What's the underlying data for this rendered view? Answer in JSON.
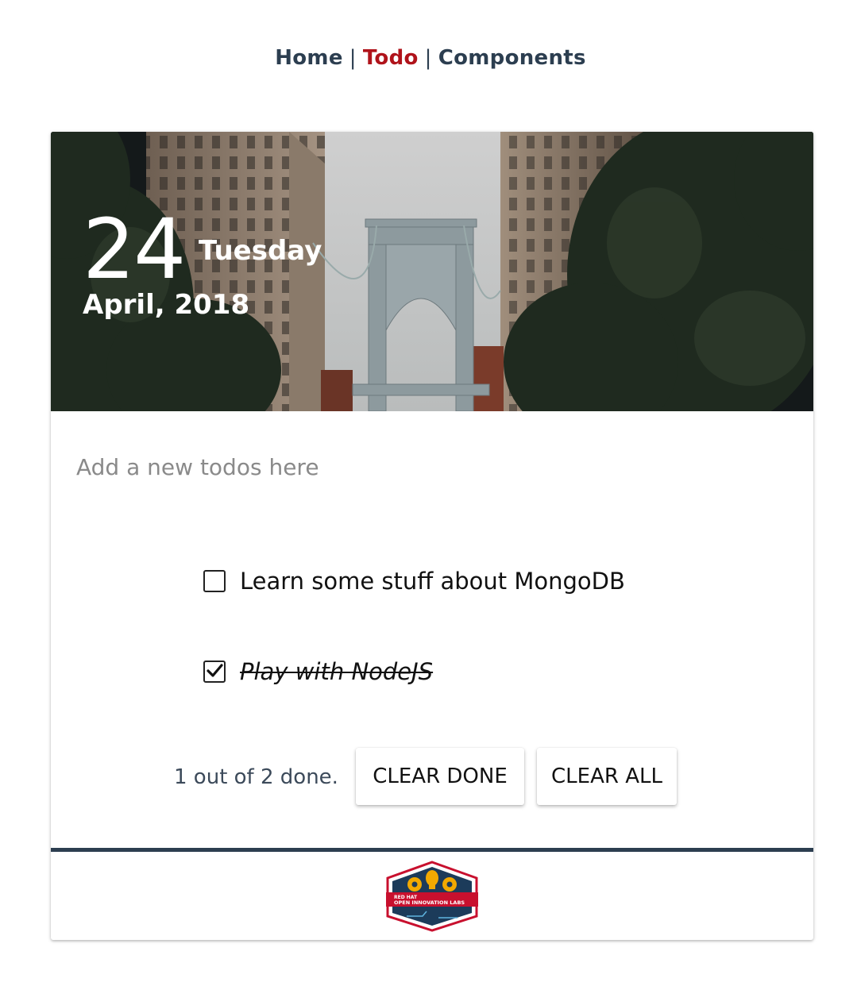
{
  "nav": {
    "home": "Home",
    "todo": "Todo",
    "components": "Components",
    "separator": "|",
    "active_color": "#b0131b",
    "text_color": "#2c3e50"
  },
  "header": {
    "day": "24",
    "weekday": "Tuesday",
    "month_year": "April, 2018"
  },
  "new_todo": {
    "placeholder": "Add a new todos here",
    "value": ""
  },
  "todos": [
    {
      "title": "Learn some stuff about MongoDB",
      "completed": false
    },
    {
      "title": "Play with NodeJS",
      "completed": true
    }
  ],
  "footer": {
    "counter": "1 out of 2 done.",
    "clear_done_label": "CLEAR DONE",
    "clear_all_label": "CLEAR ALL"
  },
  "logo": {
    "line1": "RED HAT",
    "line2": "OPEN INNOVATION LABS",
    "icon": "open-innovation-labs-logo-icon"
  }
}
